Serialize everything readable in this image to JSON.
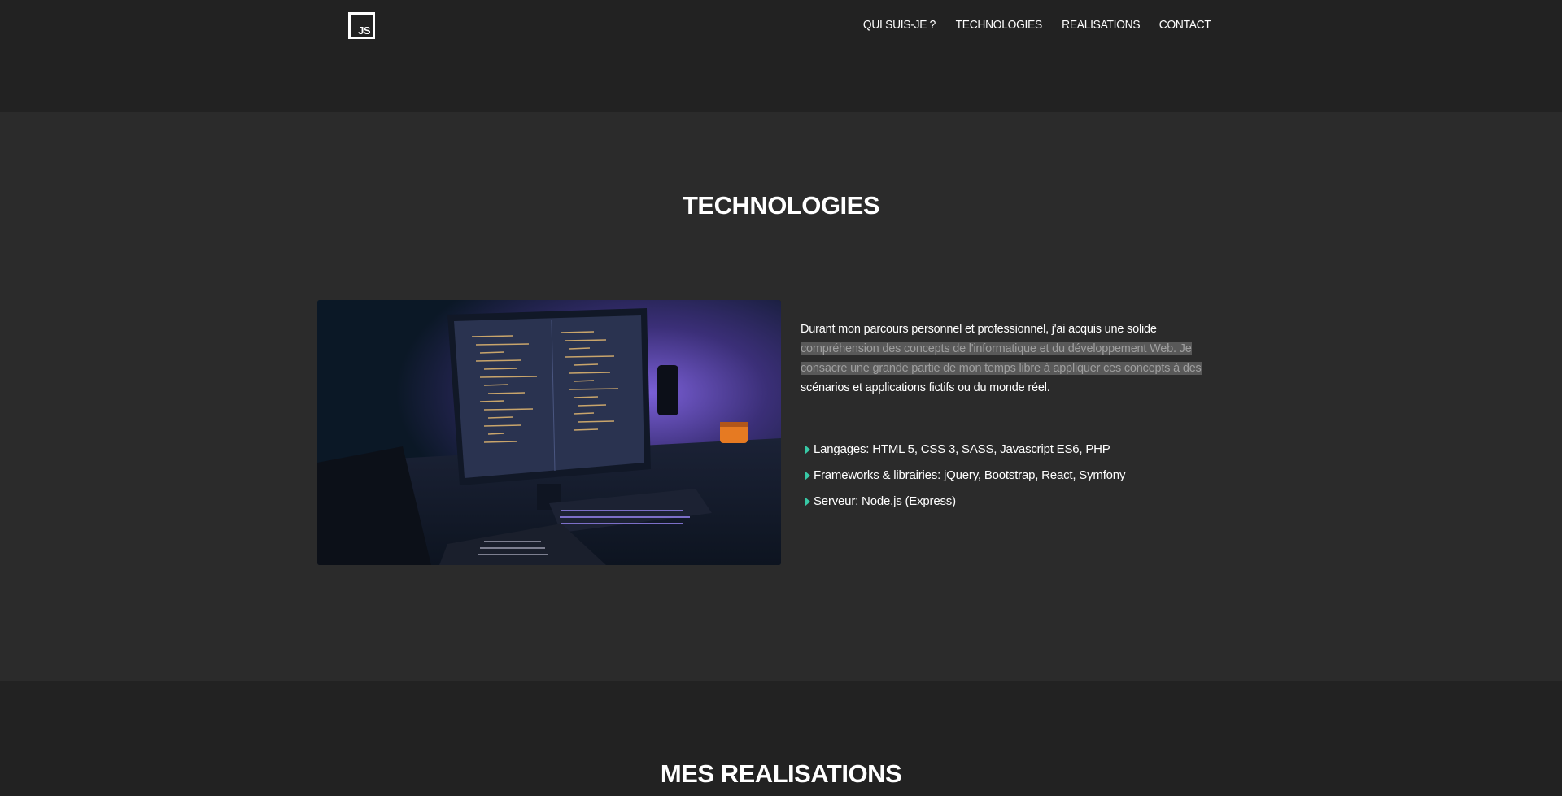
{
  "header": {
    "logo_text": "JS",
    "nav": [
      {
        "label": "QUI SUIS-JE ?"
      },
      {
        "label": "TECHNOLOGIES"
      },
      {
        "label": "REALISATIONS"
      },
      {
        "label": "CONTACT"
      }
    ]
  },
  "technologies": {
    "title": "TECHNOLOGIES",
    "intro_start": "Durant mon parcours personnel et professionnel, j'ai acquis une solide",
    "intro_highlight": "compréhension des concepts de l'informatique et du développement Web. Je consacre une grande partie de mon temps libre à appliquer ces concepts à des",
    "intro_end": "scénarios et applications fictifs ou du monde réel.",
    "items": [
      {
        "text": "Langages: HTML 5, CSS 3, SASS, Javascript ES6, PHP"
      },
      {
        "text": "Frameworks & librairies: jQuery, Bootstrap, React, Symfony"
      },
      {
        "text": "Serveur: Node.js (Express)"
      }
    ],
    "accent_color": "#38c9a6"
  },
  "realisations": {
    "title": "MES REALISATIONS"
  }
}
